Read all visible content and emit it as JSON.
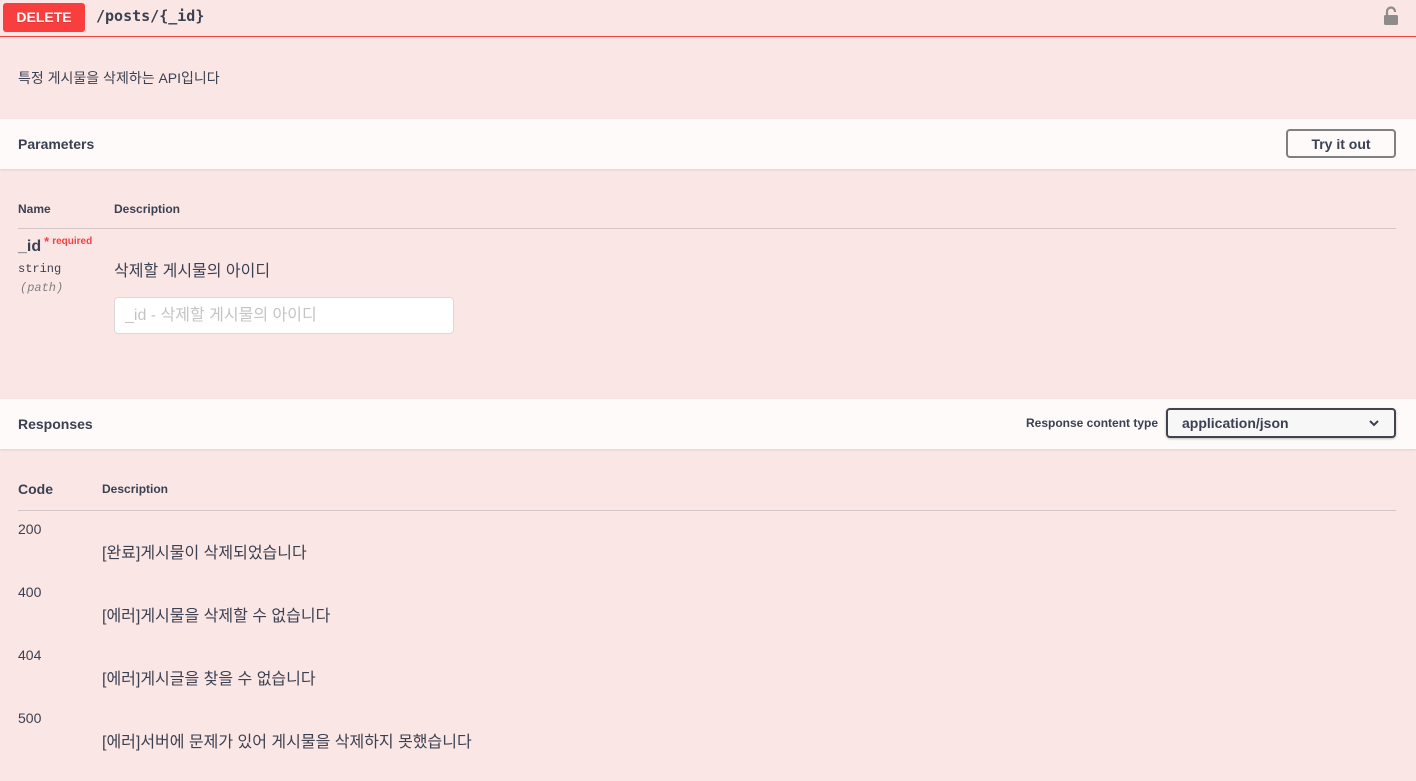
{
  "operation": {
    "method": "DELETE",
    "path": "/posts/{_id}",
    "description": "특정 게시물을 삭제하는 API입니다",
    "lock_icon": "unlocked-padlock-icon",
    "method_color": "#f93e3e"
  },
  "parameters": {
    "title": "Parameters",
    "try_label": "Try it out",
    "columns": {
      "name": "Name",
      "description": "Description"
    },
    "items": [
      {
        "name": "_id",
        "required_mark": "*",
        "required_label": "required",
        "type": "string",
        "in": "(path)",
        "description": "삭제할 게시물의 아이디",
        "placeholder": "_id - 삭제할 게시물의 아이디",
        "value": ""
      }
    ]
  },
  "responses": {
    "title": "Responses",
    "content_type_label": "Response content type",
    "content_type_selected": "application/json",
    "columns": {
      "code": "Code",
      "description": "Description"
    },
    "items": [
      {
        "code": "200",
        "description": "[완료]게시물이 삭제되었습니다"
      },
      {
        "code": "400",
        "description": "[에러]게시물을 삭제할 수 없습니다"
      },
      {
        "code": "404",
        "description": "[에러]게시글을 찾을 수 없습니다"
      },
      {
        "code": "500",
        "description": "[에러]서버에 문제가 있어 게시물을 삭제하지 못했습니다"
      }
    ]
  }
}
